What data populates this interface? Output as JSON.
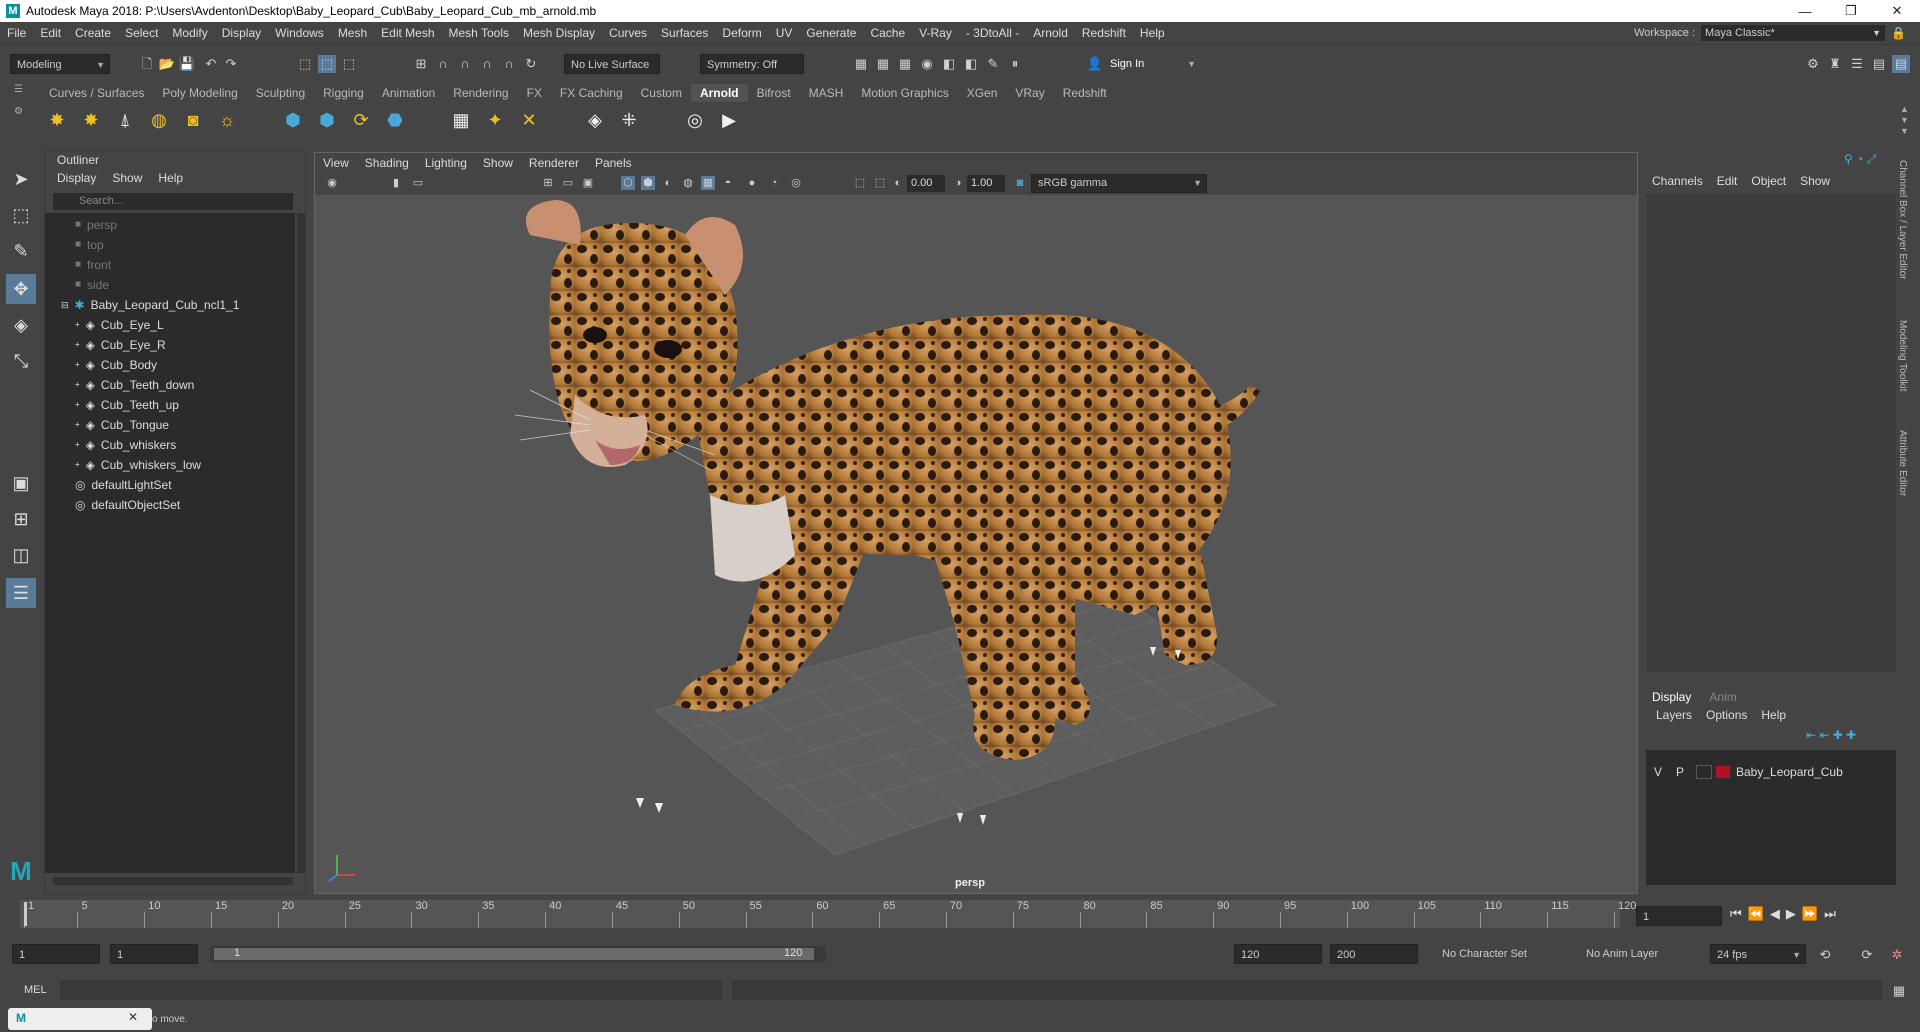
{
  "titlebar": {
    "title": "Autodesk Maya 2018: P:\\Users\\Avdenton\\Desktop\\Baby_Leopard_Cub\\Baby_Leopard_Cub_mb_arnold.mb",
    "logo": "M"
  },
  "menus": [
    "File",
    "Edit",
    "Create",
    "Select",
    "Modify",
    "Display",
    "Windows",
    "Mesh",
    "Edit Mesh",
    "Mesh Tools",
    "Mesh Display",
    "Curves",
    "Surfaces",
    "Deform",
    "UV",
    "Generate",
    "Cache",
    "V-Ray",
    "- 3DtoAll -",
    "Arnold",
    "Redshift",
    "Help"
  ],
  "workspace": {
    "label": "Workspace :",
    "value": "Maya Classic*"
  },
  "statusline": {
    "mode": "Modeling",
    "live_surface": "No Live Surface",
    "symmetry": "Symmetry: Off",
    "sign_in": "Sign In"
  },
  "shelf": {
    "tabs": [
      "Curves / Surfaces",
      "Poly Modeling",
      "Sculpting",
      "Rigging",
      "Animation",
      "Rendering",
      "FX",
      "FX Caching",
      "Custom",
      "Arnold",
      "Bifrost",
      "MASH",
      "Motion Graphics",
      "XGen",
      "VRay",
      "Redshift"
    ],
    "active": "Arnold"
  },
  "outliner": {
    "title": "Outliner",
    "menu": [
      "Display",
      "Show",
      "Help"
    ],
    "search_placeholder": "Search...",
    "cameras": [
      "persp",
      "top",
      "front",
      "side"
    ],
    "group": "Baby_Leopard_Cub_ncl1_1",
    "children": [
      "Cub_Eye_L",
      "Cub_Eye_R",
      "Cub_Body",
      "Cub_Teeth_down",
      "Cub_Teeth_up",
      "Cub_Tongue",
      "Cub_whiskers",
      "Cub_whiskers_low"
    ],
    "sets": [
      "defaultLightSet",
      "defaultObjectSet"
    ]
  },
  "viewport": {
    "menu": [
      "View",
      "Shading",
      "Lighting",
      "Show",
      "Renderer",
      "Panels"
    ],
    "exposure": "0.00",
    "gamma": "1.00",
    "colorspace": "sRGB gamma",
    "camera": "persp"
  },
  "channelbox": {
    "menu": [
      "Channels",
      "Edit",
      "Object",
      "Show"
    ],
    "side_tabs": [
      "Channel Box / Layer Editor",
      "Modeling Toolkit",
      "Attribute Editor"
    ]
  },
  "layereditor": {
    "tabs": [
      "Display",
      "Anim"
    ],
    "menu": [
      "Layers",
      "Options",
      "Help"
    ],
    "layer": {
      "v": "V",
      "p": "P",
      "name": "Baby_Leopard_Cub",
      "color": "#b0102a"
    }
  },
  "timeline": {
    "ticks": [
      "1",
      "5",
      "10",
      "15",
      "20",
      "25",
      "30",
      "35",
      "40",
      "45",
      "50",
      "55",
      "60",
      "65",
      "70",
      "75",
      "80",
      "85",
      "90",
      "95",
      "100",
      "105",
      "110",
      "115",
      "120"
    ],
    "current": "1"
  },
  "range": {
    "start": "1",
    "playback_start": "1",
    "slider_start": "1",
    "slider_end": "120",
    "playback_end": "120",
    "end": "200",
    "character_set": "No Character Set",
    "anim_layer": "No Anim Layer",
    "fps": "24 fps"
  },
  "cmdline": {
    "label": "MEL"
  },
  "helpline": {
    "text": "o move."
  }
}
